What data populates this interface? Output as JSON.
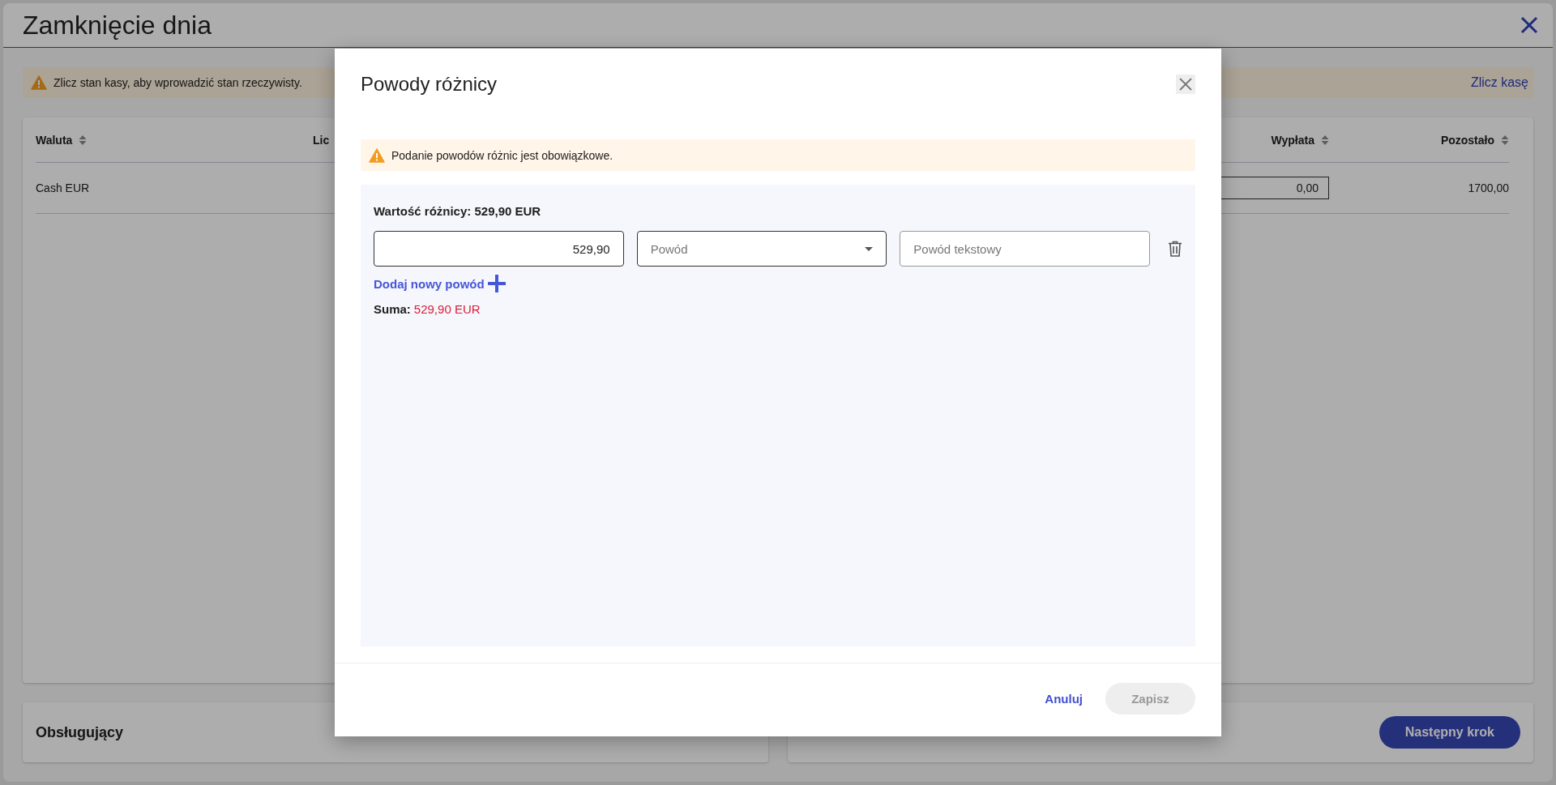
{
  "page": {
    "title": "Zamknięcie dnia",
    "warning": "Zlicz stan kasy, aby wprowadzić stan rzeczywisty.",
    "count_link": "Zlicz kasę",
    "table": {
      "columns": [
        {
          "label": "Waluta",
          "sortable": true
        },
        {
          "label": "Lic",
          "sortable": false
        },
        {
          "label": "Wypłata",
          "sortable": true
        },
        {
          "label": "Pozostało",
          "sortable": true
        }
      ],
      "rows": [
        {
          "currency": "Cash EUR",
          "payout": "0,00",
          "remaining": "1700,00"
        }
      ]
    },
    "operator_label": "Obsługujący",
    "next_button": "Następny krok"
  },
  "modal": {
    "title": "Powody różnicy",
    "warning": "Podanie powodów różnic jest obowiązkowe.",
    "difference": "Wartość różnicy: 529,90 EUR",
    "reasons": [
      {
        "amount": "529,90",
        "reason_placeholder": "Powód",
        "text_placeholder": "Powód tekstowy"
      }
    ],
    "add_link": "Dodaj nowy powód",
    "sum_label": "Suma:",
    "sum_value": "529,90 EUR",
    "cancel": "Anuluj",
    "save": {
      "label": "Zapisz",
      "disabled": true
    }
  }
}
